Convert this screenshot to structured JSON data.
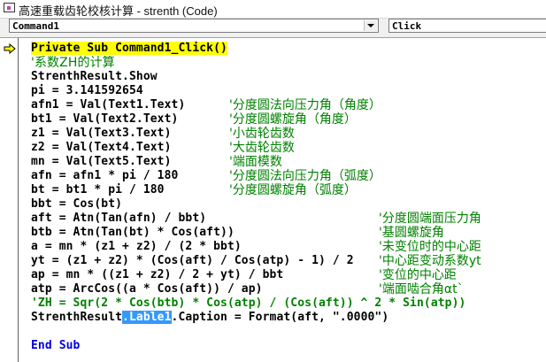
{
  "window": {
    "title": "高速重载齿轮校核计算 - strenth (Code)"
  },
  "object_combo": {
    "value": "Command1"
  },
  "procedure_combo": {
    "value": "Click"
  },
  "code": {
    "lines": [
      {
        "code": "Private Sub Command1_Click()",
        "style": "current"
      },
      {
        "code": "'系数ZH的计算",
        "style": "comment"
      },
      {
        "code": "StrenthResult.Show"
      },
      {
        "code": "pi = 3.141592654"
      },
      {
        "code": "afn1 = Val(Text1.Text)",
        "comment": "'分度圆法向压力角（角度）",
        "col": 1
      },
      {
        "code": "bt1 = Val(Text2.Text)",
        "comment": "'分度圆螺旋角（角度）",
        "col": 1
      },
      {
        "code": "z1 = Val(Text3.Text)",
        "comment": "'小齿轮齿数",
        "col": 1
      },
      {
        "code": "z2 = Val(Text4.Text)",
        "comment": "'大齿轮齿数",
        "col": 1
      },
      {
        "code": "mn = Val(Text5.Text)",
        "comment": "'端面模数",
        "col": 1
      },
      {
        "code": "afn = afn1 * pi / 180",
        "comment": "'分度圆法向压力角（弧度）",
        "col": 1
      },
      {
        "code": "bt = bt1 * pi / 180",
        "comment": "'分度圆螺旋角（弧度）",
        "col": 1
      },
      {
        "code": "bbt = Cos(bt)"
      },
      {
        "code": "aft = Atn(Tan(afn) / bbt)",
        "comment": "'分度圆端面压力角",
        "col": 2
      },
      {
        "code": "btb = Atn(Tan(bt) * Cos(aft))",
        "comment": "'基圆螺旋角",
        "col": 2
      },
      {
        "code": "a = mn * (z1 + z2) / (2 * bbt)",
        "comment": "'未变位时的中心距",
        "col": 2
      },
      {
        "code": "yt = (z1 + z2) * (Cos(aft) / Cos(atp) - 1) / 2",
        "comment": "'中心距变动系数yt",
        "col": 2
      },
      {
        "code": "ap = mn * ((z1 + z2) / 2 + yt) / bbt",
        "comment": "'变位的中心距",
        "col": 2
      },
      {
        "code": "atp = ArcCos((a * Cos(aft)) / ap)",
        "comment": "'端面啮合角αt`",
        "col": 2
      },
      {
        "code": "'ZH = Sqr(2 * Cos(btb) * Cos(atp) / (Cos(aft)) ^ 2 * Sin(atp))",
        "style": "comment-code"
      },
      {
        "code_before": "StrenthResult",
        "selected": ".Lable1",
        "code_after": ".Caption = Format(aft, \".0000\")",
        "style": "selection"
      },
      {
        "code": ""
      },
      {
        "code": "End Sub",
        "style": "keyword"
      }
    ]
  },
  "colors": {
    "highlight": "#ffff00",
    "comment": "#008000",
    "keyword": "#0000e0",
    "selection": "#3399ff"
  }
}
